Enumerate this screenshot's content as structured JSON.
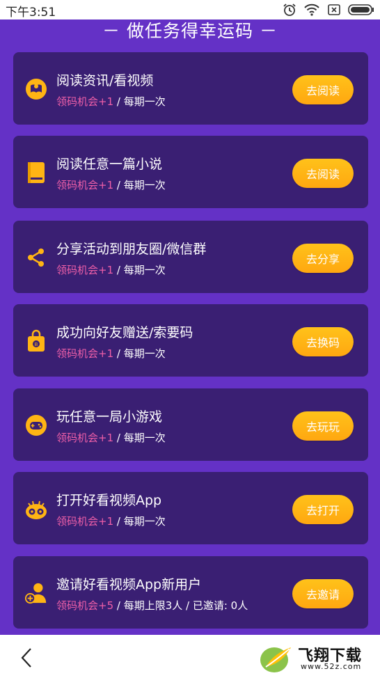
{
  "status_bar": {
    "time": "下午3:51",
    "icons": [
      "alarm-icon",
      "wifi-icon",
      "sim-icon",
      "battery-icon"
    ]
  },
  "section_title": "－ 做任务得幸运码 －",
  "tasks": [
    {
      "title": "阅读资讯/看视频",
      "reward_prefix": "领码机会+1",
      "reward_suffix": " / 每期一次",
      "button": "去阅读",
      "icon": "read-news-icon"
    },
    {
      "title": "阅读任意一篇小说",
      "reward_prefix": "领码机会+1",
      "reward_suffix": " / 每期一次",
      "button": "去阅读",
      "icon": "book-icon"
    },
    {
      "title": "分享活动到朋友圈/微信群",
      "reward_prefix": "领码机会+1",
      "reward_suffix": " / 每期一次",
      "button": "去分享",
      "icon": "share-icon"
    },
    {
      "title": "成功向好友赠送/索要码",
      "reward_prefix": "领码机会+1",
      "reward_suffix": " / 每期一次",
      "button": "去换码",
      "icon": "gift-bag-icon"
    },
    {
      "title": "玩任意一局小游戏",
      "reward_prefix": "领码机会+1",
      "reward_suffix": " / 每期一次",
      "button": "去玩玩",
      "icon": "game-icon"
    },
    {
      "title": "打开好看视频App",
      "reward_prefix": "领码机会+1",
      "reward_suffix": " / 每期一次",
      "button": "去打开",
      "icon": "video-app-icon"
    },
    {
      "title": "邀请好看视频App新用户",
      "reward_prefix": "领码机会+5",
      "reward_suffix": " / 每期上限3人 / 已邀请: 0人",
      "button": "去邀请",
      "icon": "add-user-icon"
    }
  ],
  "watermark": {
    "text": "飞翔下载",
    "url": "www.52z.com"
  },
  "colors": {
    "background": "#6431c6",
    "card": "#3a1f73",
    "accent": "#ffb414",
    "reward": "#ef5fa8"
  }
}
